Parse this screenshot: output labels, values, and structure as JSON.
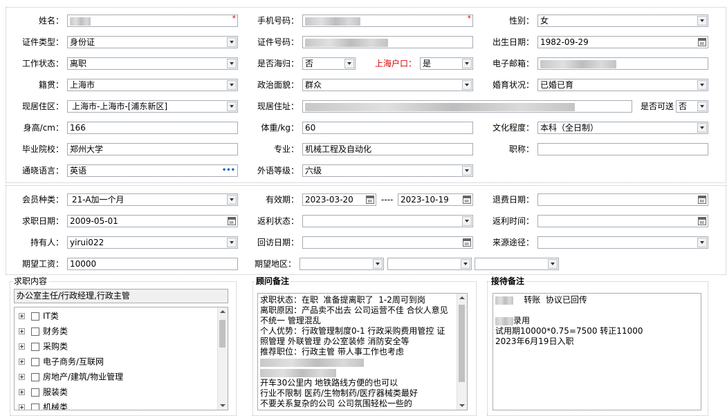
{
  "required_mark": "*",
  "personal": {
    "name": {
      "label": "姓名："
    },
    "phone": {
      "label": "手机号码："
    },
    "gender": {
      "label": "性别：",
      "value": "女"
    },
    "id_type": {
      "label": "证件类型：",
      "value": "身份证"
    },
    "id_number": {
      "label": "证件号码："
    },
    "birth_date": {
      "label": "出生日期：",
      "value": "1982-09-29"
    },
    "work_status": {
      "label": "工作状态：",
      "value": "离职"
    },
    "overseas_return": {
      "label": "是否海归：",
      "value": "否"
    },
    "shanghai_hukou": {
      "label": "上海户口：",
      "value": "是"
    },
    "email": {
      "label": "电子邮箱："
    },
    "native_place": {
      "label": "籍贯：",
      "value": "上海市"
    },
    "political_status": {
      "label": "政治面貌：",
      "value": "群众"
    },
    "marital_status": {
      "label": "婚育状况：",
      "value": "已婚已育"
    },
    "residence_area": {
      "label": "现居住区：",
      "value": "上海市-上海市-[浦东新区]"
    },
    "address": {
      "label": "现居住址："
    },
    "can_visit": {
      "label": "是否可送",
      "value": "否"
    },
    "height": {
      "label": "身高/cm：",
      "value": "166"
    },
    "weight": {
      "label": "体重/kg：",
      "value": "60"
    },
    "education": {
      "label": "文化程度：",
      "value": "本科（全日制）"
    },
    "school": {
      "label": "毕业院校：",
      "value": "郑州大学"
    },
    "major": {
      "label": "专业：",
      "value": "机械工程及自动化"
    },
    "job_title": {
      "label": "职称：",
      "value": ""
    },
    "language": {
      "label": "通晓语言：",
      "value": "英语",
      "more": "•••"
    },
    "foreign_level": {
      "label": "外语等级：",
      "value": "六级"
    }
  },
  "membership": {
    "member_type": {
      "label": "会员种类：",
      "value": "21-A加一个月"
    },
    "validity": {
      "label": "有效期：",
      "start": "2023-03-20",
      "separator": "----",
      "end": "2023-10-19"
    },
    "refund_date": {
      "label": "退费日期：",
      "value": ""
    },
    "apply_date": {
      "label": "求职日期：",
      "value": "2009-05-01"
    },
    "rebate_status": {
      "label": "返利状态：",
      "value": ""
    },
    "rebate_time": {
      "label": "返利时间：",
      "value": ""
    },
    "holder": {
      "label": "持有人：",
      "value": "yirui022"
    },
    "visit_date": {
      "label": "回访日期：",
      "value": ""
    },
    "source": {
      "label": "来源途径：",
      "value": ""
    },
    "expected_salary": {
      "label": "期望工资：",
      "value": "10000"
    },
    "expected_area": {
      "label": "期望地区：",
      "values": [
        "",
        "",
        ""
      ]
    }
  },
  "job_content": {
    "title": "求职内容",
    "selected": "办公室主任/行政经理,行政主管",
    "categories": [
      "IT类",
      "财务类",
      "采购类",
      "电子商务/互联网",
      "房地产/建筑/物业管理",
      "服装类",
      "机械类"
    ]
  },
  "consultant_notes": {
    "title": "顾问备注",
    "lines": [
      "求职状态：在职  准备提离职了  1-2周可到岗",
      "离职原因：产品卖不出去 公司运营不佳 合伙人意见",
      "不统一 管理混乱",
      "个人优势：行政管理制度0-1 行政采购费用管控 证",
      "照管理 外联管理 办公室装修 消防安全等",
      "推荐职位：行政主管 带人事工作也考虑",
      "",
      "",
      "开车30公里内 地铁路线方便的也可以",
      "行业不限制 医药/生物制药/医疗器械类最好",
      "不要关系复杂的公司 公司氛围轻松一些的"
    ]
  },
  "reception_notes": {
    "title": "接待备注",
    "line1_suffix": "转账  协议已回传",
    "line2_suffix": "录用",
    "line3": "试用期10000*0.75=7500 转正11000",
    "line4": "2023年6月19日入职"
  }
}
